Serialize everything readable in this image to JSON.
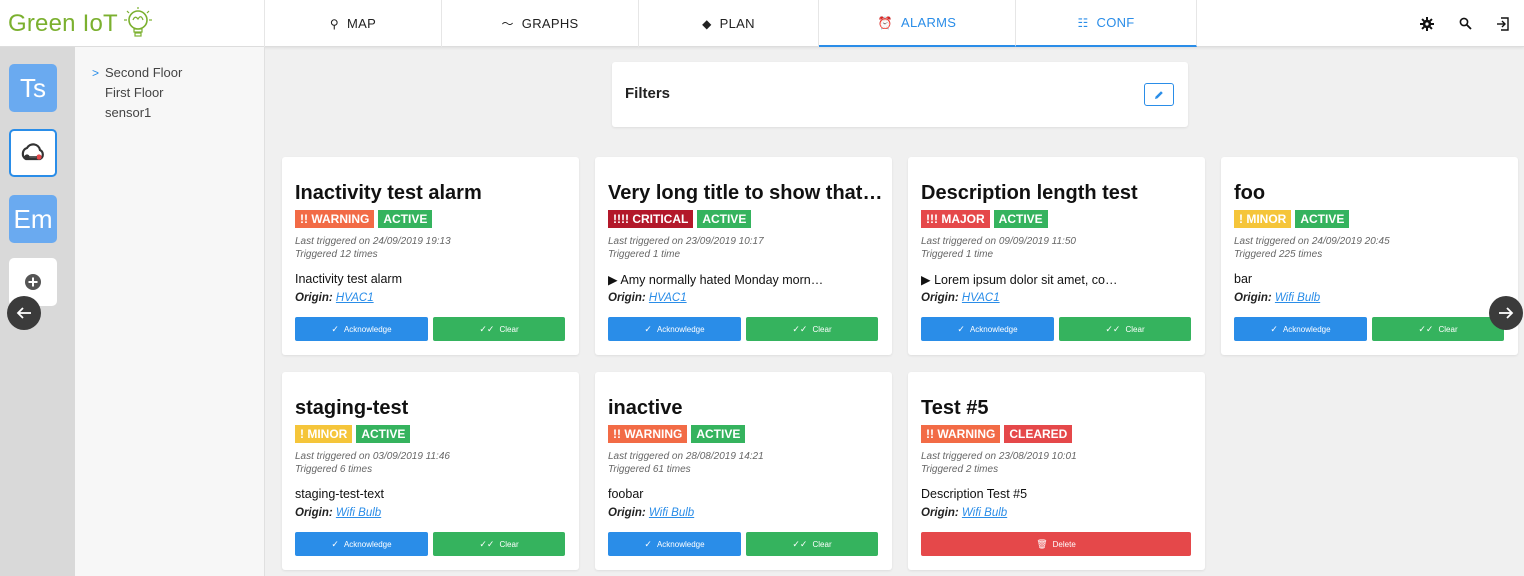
{
  "app": {
    "logo_text": "Green IoT"
  },
  "tabs": [
    {
      "label": "MAP",
      "icon": "map-marker-icon",
      "glyph": "⚲"
    },
    {
      "label": "GRAPHS",
      "icon": "graph-line-icon",
      "glyph": "〜"
    },
    {
      "label": "PLAN",
      "icon": "layers-icon",
      "glyph": "◆"
    },
    {
      "label": "ALARMS",
      "icon": "alarm-clock-icon",
      "glyph": "⏰"
    },
    {
      "label": "CONF",
      "icon": "list-icon",
      "glyph": "☷"
    }
  ],
  "header_icons": [
    "gear-icon",
    "search-icon",
    "logout-icon"
  ],
  "apps": {
    "ts": "Ts",
    "em": "Em"
  },
  "tree": {
    "items": [
      "Second Floor",
      "First Floor",
      "sensor1"
    ]
  },
  "filters": {
    "title": "Filters"
  },
  "labels": {
    "origin": "Origin:",
    "acknowledge": "Acknowledge",
    "clear": "Clear",
    "delete": "Delete"
  },
  "colors": {
    "warning": "#f26b46",
    "critical": "#b3182a",
    "major": "#e5484a",
    "minor": "#f5c53a",
    "active": "#35b35e",
    "cleared": "#e5484a",
    "accent": "#2a8de8"
  },
  "alarms": [
    {
      "title": "Inactivity test alarm",
      "severity": "!! WARNING",
      "sev_color": "#f26b46",
      "state": "ACTIVE",
      "state_color": "#35b35e",
      "last_triggered": "Last triggered on 24/09/2019 19:13",
      "triggered_count": "Triggered 12 times",
      "description": "Inactivity test alarm",
      "origin": "HVAC1",
      "actions": "ack"
    },
    {
      "title": "Very long title to show that …",
      "severity": "!!!! CRITICAL",
      "sev_color": "#b3182a",
      "state": "ACTIVE",
      "state_color": "#35b35e",
      "last_triggered": "Last triggered on 23/09/2019 10:17",
      "triggered_count": "Triggered 1 time",
      "description": "▶ Amy normally hated Monday morn…",
      "origin": "HVAC1",
      "actions": "ack"
    },
    {
      "title": "Description length test",
      "severity": "!!! MAJOR",
      "sev_color": "#e5484a",
      "state": "ACTIVE",
      "state_color": "#35b35e",
      "last_triggered": "Last triggered on 09/09/2019 11:50",
      "triggered_count": "Triggered 1 time",
      "description": "▶ Lorem ipsum dolor sit amet, co…",
      "origin": "HVAC1",
      "actions": "ack"
    },
    {
      "title": "foo",
      "severity": "! MINOR",
      "sev_color": "#f5c53a",
      "state": "ACTIVE",
      "state_color": "#35b35e",
      "last_triggered": "Last triggered on 24/09/2019 20:45",
      "triggered_count": "Triggered 225 times",
      "description": "bar",
      "origin": "Wifi Bulb",
      "actions": "ack"
    },
    {
      "title": "staging-test",
      "severity": "! MINOR",
      "sev_color": "#f5c53a",
      "state": "ACTIVE",
      "state_color": "#35b35e",
      "last_triggered": "Last triggered on 03/09/2019 11:46",
      "triggered_count": "Triggered 6 times",
      "description": "staging-test-text",
      "origin": "Wifi Bulb",
      "actions": "ack"
    },
    {
      "title": "inactive",
      "severity": "!! WARNING",
      "sev_color": "#f26b46",
      "state": "ACTIVE",
      "state_color": "#35b35e",
      "last_triggered": "Last triggered on 28/08/2019 14:21",
      "triggered_count": "Triggered 61 times",
      "description": "foobar",
      "origin": "Wifi Bulb",
      "actions": "ack"
    },
    {
      "title": "Test #5",
      "severity": "!! WARNING",
      "sev_color": "#f26b46",
      "state": "CLEARED",
      "state_color": "#e5484a",
      "last_triggered": "Last triggered on 23/08/2019 10:01",
      "triggered_count": "Triggered 2 times",
      "description": "Description Test #5",
      "origin": "Wifi Bulb",
      "actions": "delete"
    }
  ]
}
